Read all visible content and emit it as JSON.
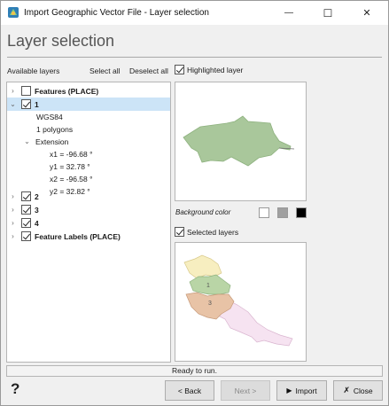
{
  "window": {
    "title": "Import Geographic Vector File - Layer selection",
    "minimize_glyph": "—",
    "maximize_glyph": "☐",
    "close_glyph": "✕"
  },
  "page": {
    "heading": "Layer selection"
  },
  "toolbar": {
    "available_layers_label": "Available layers",
    "select_all_label": "Select all",
    "deselect_all_label": "Deselect all",
    "highlighted_layer_label": "Highlighted layer",
    "highlighted_layer_checked": true
  },
  "tree": {
    "items": [
      {
        "label": "Features (PLACE)",
        "checked": false,
        "expanded": false
      },
      {
        "label": "1",
        "checked": true,
        "expanded": true,
        "selected": true
      },
      {
        "label": "WGS84"
      },
      {
        "label": "1 polygons"
      },
      {
        "label": "Extension",
        "expanded": true
      },
      {
        "label": "x1 = -96.68 °"
      },
      {
        "label": "y1 = 32.78 °"
      },
      {
        "label": "x2 = -96.58 °"
      },
      {
        "label": "y2 = 32.82 °"
      },
      {
        "label": "2",
        "checked": true,
        "expanded": false
      },
      {
        "label": "3",
        "checked": true,
        "expanded": false
      },
      {
        "label": "4",
        "checked": true,
        "expanded": false
      },
      {
        "label": "Feature Labels (PLACE)",
        "checked": true,
        "expanded": false
      }
    ]
  },
  "preview": {
    "background_color_label": "Background color",
    "background_swatches": [
      "#ffffff",
      "#a0a0a0",
      "#000000"
    ],
    "selected_layers_label": "Selected layers",
    "selected_layers_checked": true,
    "map_labels": [
      "1",
      "3"
    ],
    "colors": {
      "highlight_fill": "#a9c79b",
      "layer_yellow": "#f7eec0",
      "layer_green": "#b9d5a6",
      "layer_orange": "#e8c3a6",
      "layer_pink": "#f6e3f1"
    }
  },
  "status": {
    "text": "Ready to run."
  },
  "buttons": {
    "help_glyph": "?",
    "back_label": "< Back",
    "next_label": "Next >",
    "import_label": "Import",
    "close_label": "Close"
  }
}
